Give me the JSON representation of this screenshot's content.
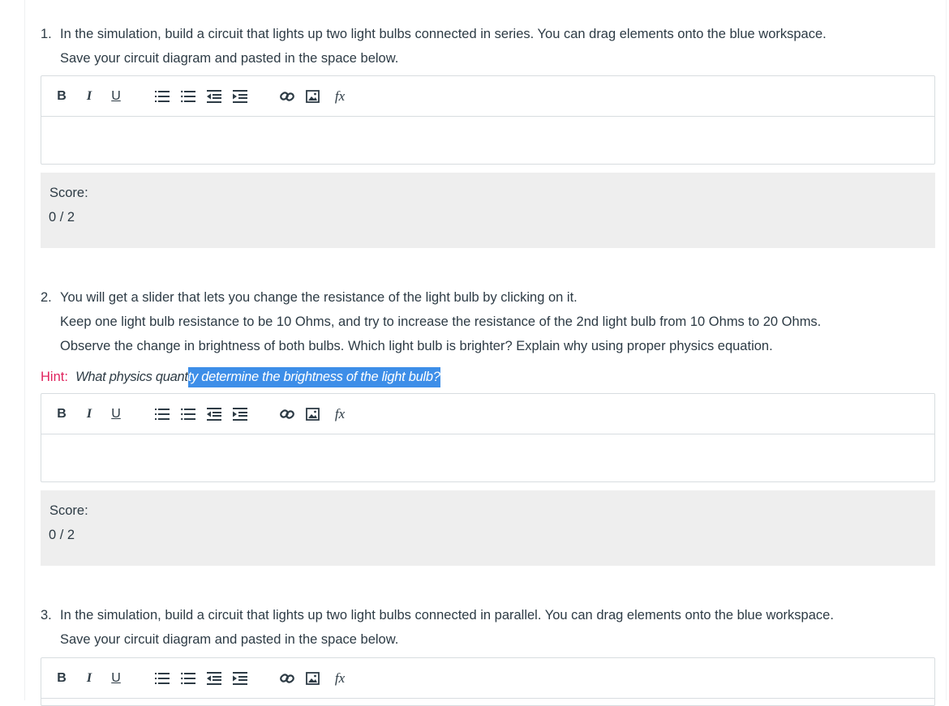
{
  "toolbar": {
    "bold": "B",
    "italic": "I",
    "underline": "U",
    "fx": "fx",
    "icons": [
      "ordered-list-icon",
      "bullet-list-icon",
      "outdent-icon",
      "indent-icon",
      "link-icon",
      "image-icon",
      "equation-icon"
    ]
  },
  "questions": [
    {
      "number": "1.",
      "lines": [
        "In the simulation, build a circuit that lights up two light bulbs connected in series. You can drag elements onto the blue workspace.",
        "Save your circuit diagram and pasted in the space below."
      ],
      "score_label": "Score:",
      "score_value": "0 / 2"
    },
    {
      "number": "2.",
      "lines": [
        "You will get a slider that lets you change the resistance of the light bulb by clicking on it.",
        "Keep one light bulb resistance to be 10 Ohms, and try to increase the resistance of the 2nd light bulb from 10 Ohms to 20 Ohms.",
        "Observe the change in brightness of both bulbs. Which light bulb is brighter? Explain why using proper physics equation."
      ],
      "hint": {
        "label": "Hint:",
        "text_before": "What physics quant",
        "text_selected": "ty determine the brightness of the light bulb?"
      },
      "score_label": "Score:",
      "score_value": "0 / 2"
    },
    {
      "number": "3.",
      "lines": [
        "In the simulation, build a circuit that lights up two light bulbs connected in parallel. You can drag elements onto the blue workspace.",
        "Save your circuit diagram and pasted in the space below."
      ]
    }
  ],
  "colors": {
    "text": "#2d3b45",
    "hint_label": "#e0245e",
    "selection": "#3d8ee8",
    "score_bg": "#eeeeee",
    "border": "#d8dde0"
  }
}
